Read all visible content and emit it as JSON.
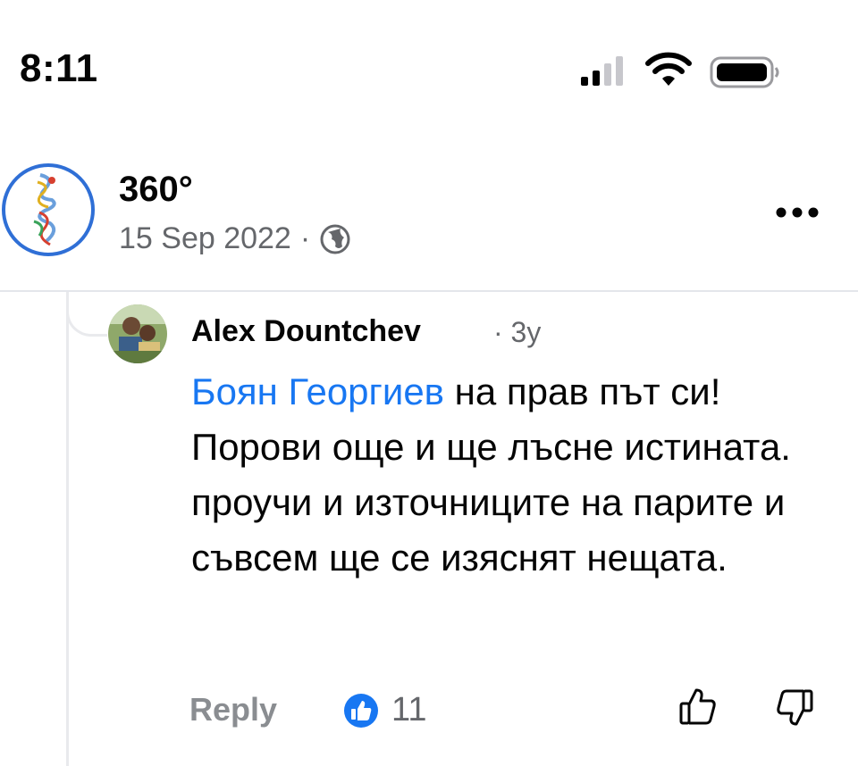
{
  "status_bar": {
    "time": "8:11"
  },
  "post": {
    "page_name": "360°",
    "date": "15 Sep 2022",
    "separator": "·"
  },
  "comment": {
    "author": "Alex Dountchev",
    "age": "· 3y",
    "mention": "Боян Георгиев",
    "text": " на прав път си! Порови още и ще лъсне истината. проучи и източниците на парите и съвсем ще се изяснят нещата.",
    "reply_label": "Reply",
    "like_count": "11"
  },
  "colors": {
    "accent": "#1877f2",
    "muted": "#65676b",
    "reply": "#8a8d91",
    "divider": "#e4e6eb"
  }
}
